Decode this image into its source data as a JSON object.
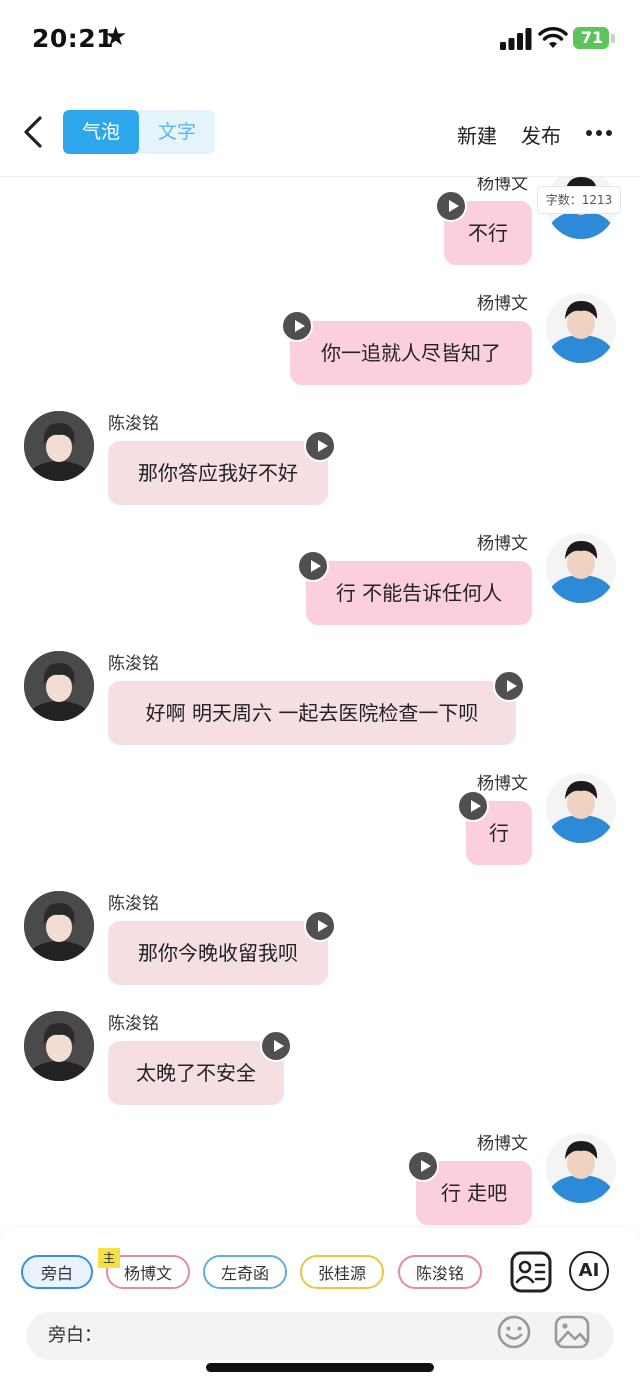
{
  "status_bar": {
    "time": "20:21",
    "battery": "71"
  },
  "header": {
    "tabs": [
      {
        "label": "气泡",
        "active": true
      },
      {
        "label": "文字",
        "active": false
      }
    ],
    "new_label": "新建",
    "publish_label": "发布"
  },
  "word_count": "字数：1213",
  "messages": [
    {
      "speaker": "杨博文",
      "side": "right",
      "text": "不行"
    },
    {
      "speaker": "杨博文",
      "side": "right",
      "text": "你一追就人尽皆知了"
    },
    {
      "speaker": "陈浚铭",
      "side": "left",
      "text": "那你答应我好不好"
    },
    {
      "speaker": "杨博文",
      "side": "right",
      "text": "行 不能告诉任何人"
    },
    {
      "speaker": "陈浚铭",
      "side": "left",
      "text": "好啊 明天周六 一起去医院检查一下呗"
    },
    {
      "speaker": "杨博文",
      "side": "right",
      "text": "行"
    },
    {
      "speaker": "陈浚铭",
      "side": "left",
      "text": "那你今晚收留我呗"
    },
    {
      "speaker": "陈浚铭",
      "side": "left",
      "text": "太晚了不安全"
    },
    {
      "speaker": "杨博文",
      "side": "right",
      "text": "行 走吧"
    }
  ],
  "characters": {
    "narration": "旁白",
    "yang": "杨博文",
    "main_badge": "主",
    "zuo": "左奇函",
    "zhang": "张桂源",
    "chen": "陈浚铭"
  },
  "ai_label": "AI",
  "input": {
    "label": "旁白："
  },
  "colors": {
    "accent_blue": "#2fa7ec",
    "bubble_right": "#fbd0dc",
    "bubble_left": "#f5dfe3",
    "battery_green": "#5dc35b"
  }
}
